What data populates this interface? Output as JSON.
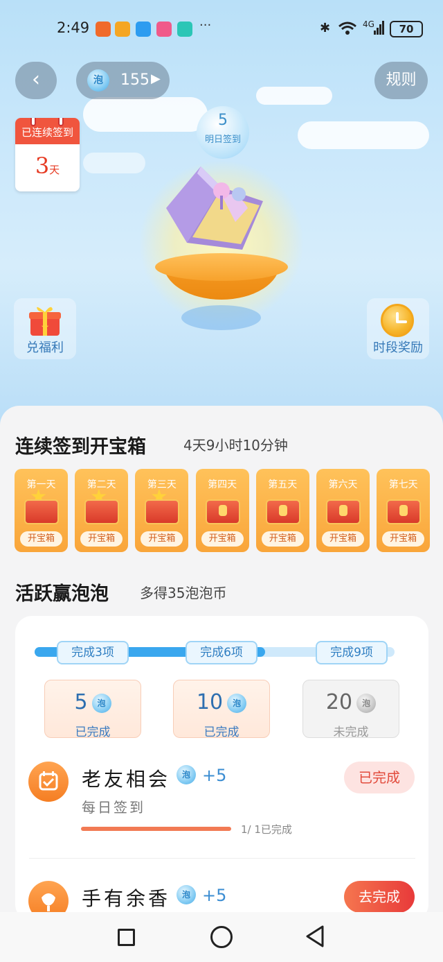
{
  "status_bar": {
    "time": "2:49",
    "dots": "···",
    "battery": "70",
    "signal_label": "4G"
  },
  "header": {
    "coin_glyph": "泡",
    "coin_count": "155",
    "rules_label": "规则"
  },
  "streak": {
    "label": "已连续签到",
    "value": "3",
    "unit": "天"
  },
  "tomorrow": {
    "value": "5",
    "label": "明日签到"
  },
  "side": {
    "exchange_label": "兑福利",
    "time_reward_label": "时段奖励"
  },
  "checkin_section": {
    "title": "连续签到开宝箱",
    "countdown": "4天9小时10分钟",
    "days": [
      {
        "label": "第一天",
        "button": "开宝箱",
        "opened": true
      },
      {
        "label": "第二天",
        "button": "开宝箱",
        "opened": true
      },
      {
        "label": "第三天",
        "button": "开宝箱",
        "opened": true
      },
      {
        "label": "第四天",
        "button": "开宝箱",
        "opened": false
      },
      {
        "label": "第五天",
        "button": "开宝箱",
        "opened": false
      },
      {
        "label": "第六天",
        "button": "开宝箱",
        "opened": false
      },
      {
        "label": "第七天",
        "button": "开宝箱",
        "opened": false
      }
    ]
  },
  "active_section": {
    "title": "活跃赢泡泡",
    "subtitle": "多得35泡泡币",
    "progress_fraction": 0.64,
    "milestones": [
      "完成3项",
      "完成6项",
      "完成9项"
    ],
    "rewards": [
      {
        "amount": "5",
        "status": "已完成"
      },
      {
        "amount": "10",
        "status": "已完成"
      },
      {
        "amount": "20",
        "status": "未完成"
      }
    ]
  },
  "tasks": [
    {
      "title": "老友相会",
      "bonus": "+5",
      "subtitle": "每日签到",
      "progress": "1/ 1已完成",
      "progress_fraction": 1.0,
      "button": "已完成"
    },
    {
      "title": "手有余香",
      "bonus": "+5",
      "button": "去完成"
    }
  ],
  "colors": {
    "accent_orange": "#f9a53a",
    "accent_blue": "#3aa7ee",
    "done_red": "#e24b3c"
  }
}
